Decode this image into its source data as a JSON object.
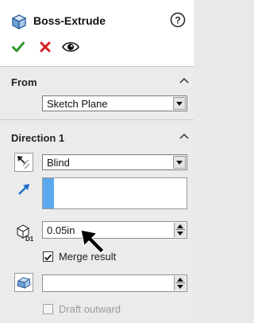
{
  "header": {
    "title": "Boss-Extrude",
    "help_icon": "help-icon",
    "ok_icon": "checkmark-icon",
    "cancel_icon": "close-icon",
    "preview_icon": "eye-icon",
    "colors": {
      "ok": "#2e9a2e",
      "cancel": "#d42020"
    }
  },
  "from": {
    "label": "From",
    "start_condition": "Sketch Plane"
  },
  "direction1": {
    "label": "Direction 1",
    "end_condition": "Blind",
    "depth": "0.05in",
    "merge_result_label": "Merge result",
    "merge_result_checked": true,
    "draft_outward_label": "Draft outward",
    "draft_outward_checked": false,
    "draft_outward_enabled": false,
    "selection_color": "#5aa9ef"
  }
}
